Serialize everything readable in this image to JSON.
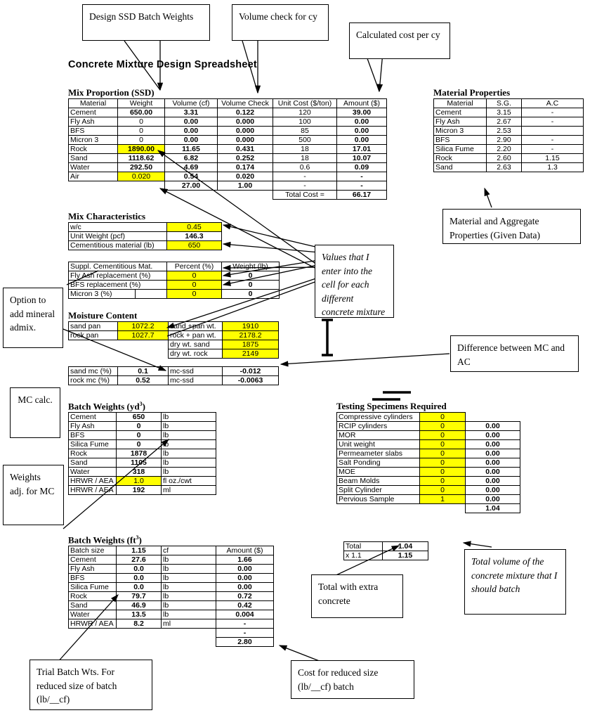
{
  "page_title": "Concrete Mixture Design Spreadsheet",
  "colors": {
    "highlight": "#ffff00",
    "border": "#000000",
    "background": "#ffffff"
  },
  "callouts": {
    "design_ssd": "Design SSD Batch Weights",
    "volume_check": "Volume check for cy",
    "calc_cost": "Calculated cost per cy",
    "material_props": "Material and Aggregate Properties (Given Data)",
    "values_enter": "Values that I enter into the cell for each different concrete mixture",
    "option_mineral": "Option to add mineral admix.",
    "difference_mc_ac": "Difference between MC and AC",
    "mc_calc": "MC calc.",
    "weights_adj": "Weights adj. for MC",
    "total_extra": "Total with extra concrete",
    "total_volume": "Total volume of the concrete mixture that I should batch",
    "trial_batch": "Trial Batch Wts. For reduced size of batch (lb/__cf)",
    "cost_reduced": "Cost for reduced size (lb/__cf) batch"
  },
  "mix_proportion": {
    "title": "Mix Proportion (SSD)",
    "headers": [
      "Material",
      "Weight",
      "Volume (cf)",
      "Volume Check",
      "Unit Cost ($/ton)",
      "Amount ($)"
    ],
    "rows": [
      {
        "material": "Cement",
        "weight": "650.00",
        "volume": "3.31",
        "check": "0.122",
        "unit_cost": "120",
        "amount": "39.00"
      },
      {
        "material": "Fly Ash",
        "weight": "0",
        "volume": "0.00",
        "check": "0.000",
        "unit_cost": "100",
        "amount": "0.00"
      },
      {
        "material": "BFS",
        "weight": "0",
        "volume": "0.00",
        "check": "0.000",
        "unit_cost": "85",
        "amount": "0.00"
      },
      {
        "material": "Micron 3",
        "weight": "0",
        "volume": "0.00",
        "check": "0.000",
        "unit_cost": "500",
        "amount": "0.00"
      },
      {
        "material": "Rock",
        "weight": "1890.00",
        "volume": "11.65",
        "check": "0.431",
        "unit_cost": "18",
        "amount": "17.01"
      },
      {
        "material": "Sand",
        "weight": "1118.62",
        "volume": "6.82",
        "check": "0.252",
        "unit_cost": "18",
        "amount": "10.07"
      },
      {
        "material": "Water",
        "weight": "292.50",
        "volume": "4.69",
        "check": "0.174",
        "unit_cost": "0.6",
        "amount": "0.09"
      },
      {
        "material": "Air",
        "weight": "0.020",
        "volume": "0.54",
        "check": "0.020",
        "unit_cost": "-",
        "amount": "-"
      }
    ],
    "totals_row": {
      "material": "",
      "weight": "",
      "volume": "27.00",
      "check": "1.00",
      "unit_cost": "-",
      "amount": "-"
    },
    "total_cost_label": "Total Cost =",
    "total_cost_value": "66.17"
  },
  "material_properties": {
    "title": "Material Properties",
    "headers": [
      "Material",
      "S.G.",
      "A.C"
    ],
    "rows": [
      {
        "material": "Cement",
        "sg": "3.15",
        "ac": "-"
      },
      {
        "material": "Fly Ash",
        "sg": "2.67",
        "ac": "-"
      },
      {
        "material": "Micron 3",
        "sg": "2.53",
        "ac": ""
      },
      {
        "material": "BFS",
        "sg": "2.90",
        "ac": "-"
      },
      {
        "material": "Silica Fume",
        "sg": "2.20",
        "ac": "-"
      },
      {
        "material": "Rock",
        "sg": "2.60",
        "ac": "1.15"
      },
      {
        "material": "Sand",
        "sg": "2.63",
        "ac": "1.3"
      }
    ]
  },
  "mix_characteristics": {
    "title": "Mix Characteristics",
    "rows": [
      {
        "label": "w/c",
        "value": "0.45"
      },
      {
        "label": "Unit Weight (pcf)",
        "value": "146.3"
      },
      {
        "label": "Cementitious material (lb)",
        "value": "650"
      }
    ]
  },
  "scm": {
    "headers": [
      "Suppl. Cementitious Mat.",
      "Percent (%)",
      "Weight (lb)"
    ],
    "rows": [
      {
        "label": "Fly Ash replacement (%)",
        "percent": "0",
        "weight": "0"
      },
      {
        "label": "BFS replacement (%)",
        "percent": "0",
        "weight": "0"
      },
      {
        "label": "Micron 3 (%)",
        "percent": "0",
        "weight": "0"
      }
    ]
  },
  "moisture_content": {
    "title": "Moisture Content",
    "left_rows": [
      {
        "label": "sand pan",
        "value": "1072.2"
      },
      {
        "label": "rock pan",
        "value": "1027.7"
      }
    ],
    "right_rows": [
      {
        "label": "sand +pan wt.",
        "value": "1910"
      },
      {
        "label": "rock + pan wt.",
        "value": "2178.2"
      },
      {
        "label": "dry wt. sand",
        "value": "1875"
      },
      {
        "label": "dry wt. rock",
        "value": "2149"
      }
    ]
  },
  "mc_table": {
    "rows": [
      {
        "label": "sand mc (%)",
        "value": "0.1",
        "mclabel": "mc-ssd",
        "mcval": "-0.012"
      },
      {
        "label": "rock mc (%)",
        "value": "0.52",
        "mclabel": "mc-ssd",
        "mcval": "-0.0063"
      }
    ]
  },
  "batch_weights_yd3": {
    "title": "Batch Weights (yd",
    "title_sup": "3",
    "title_end": ")",
    "rows": [
      {
        "label": "Cement",
        "value": "650",
        "unit": "lb",
        "hl": false
      },
      {
        "label": "Fly Ash",
        "value": "0",
        "unit": "lb",
        "hl": false
      },
      {
        "label": "BFS",
        "value": "0",
        "unit": "lb",
        "hl": false
      },
      {
        "label": "Silica Fume",
        "value": "0",
        "unit": "lb",
        "hl": false
      },
      {
        "label": "Rock",
        "value": "1878",
        "unit": "lb",
        "hl": false
      },
      {
        "label": "Sand",
        "value": "1105",
        "unit": "lb",
        "hl": false
      },
      {
        "label": "Water",
        "value": "318",
        "unit": "lb",
        "hl": false
      },
      {
        "label": "HRWR / AEA",
        "value": "1.0",
        "unit": "fl oz./cwt",
        "hl": true
      },
      {
        "label": "HRWR / AEA",
        "value": "192",
        "unit": "ml",
        "hl": false
      }
    ]
  },
  "batch_weights_ft3": {
    "title": "Batch Weights (ft",
    "title_sup": "3",
    "title_end": ")",
    "amount_header": "Amount ($)",
    "rows": [
      {
        "label": "Batch size",
        "value": "1.15",
        "unit": "cf",
        "amount": "Amount ($)",
        "amount_bold": false
      },
      {
        "label": "Cement",
        "value": "27.6",
        "unit": "lb",
        "amount": "1.66",
        "amount_bold": true
      },
      {
        "label": "Fly Ash",
        "value": "0.0",
        "unit": "lb",
        "amount": "0.00",
        "amount_bold": true
      },
      {
        "label": "BFS",
        "value": "0.0",
        "unit": "lb",
        "amount": "0.00",
        "amount_bold": true
      },
      {
        "label": "Silica Fume",
        "value": "0.0",
        "unit": "lb",
        "amount": "0.00",
        "amount_bold": true
      },
      {
        "label": "Rock",
        "value": "79.7",
        "unit": "lb",
        "amount": "0.72",
        "amount_bold": true
      },
      {
        "label": "Sand",
        "value": "46.9",
        "unit": "lb",
        "amount": "0.42",
        "amount_bold": true
      },
      {
        "label": "Water",
        "value": "13.5",
        "unit": "lb",
        "amount": "0.004",
        "amount_bold": true
      },
      {
        "label": "HRWR / AEA",
        "value": "8.2",
        "unit": "ml",
        "amount": "-",
        "amount_bold": true
      }
    ],
    "tail_rows": [
      "-",
      "2.80"
    ]
  },
  "testing_specimens": {
    "title": "Testing Specimens Required",
    "rows": [
      {
        "label": "Compressive cylinders",
        "count": "0",
        "amount": ""
      },
      {
        "label": "RCIP cylinders",
        "count": "0",
        "amount": "0.00"
      },
      {
        "label": "MOR",
        "count": "0",
        "amount": "0.00"
      },
      {
        "label": "Unit weight",
        "count": "0",
        "amount": "0.00"
      },
      {
        "label": "Permeameter slabs",
        "count": "0",
        "amount": "0.00"
      },
      {
        "label": "Salt Ponding",
        "count": "0",
        "amount": "0.00"
      },
      {
        "label": "MOE",
        "count": "0",
        "amount": "0.00"
      },
      {
        "label": "Beam Molds",
        "count": "0",
        "amount": "0.00"
      },
      {
        "label": "Split Cylinder",
        "count": "0",
        "amount": "0.00"
      },
      {
        "label": "Pervious Sample",
        "count": "1",
        "amount": "0.00"
      }
    ],
    "sum_value": "1.04"
  },
  "total_box": {
    "rows": [
      {
        "label": "Total",
        "value": "1.04"
      },
      {
        "label": "x 1.1",
        "value": "1.15"
      }
    ]
  }
}
